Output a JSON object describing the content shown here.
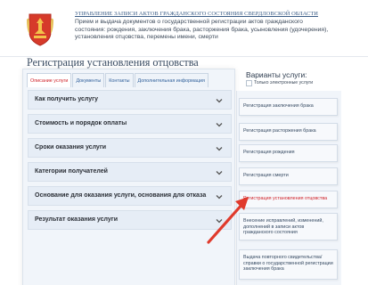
{
  "header": {
    "title": "УПРАВЛЕНИЕ ЗАПИСИ АКТОВ ГРАЖДАНСКОГО СОСТОЯНИЯ СВЕРДЛОВСКОЙ ОБЛАСТИ",
    "description": "Прием и выдача документов о государственной регистрации актов гражданского состояния: рождения, заключения брака, расторжения брака, усыновления (удочерения), установления отцовства, перемены имени, смерти"
  },
  "page_title": "Регистрация установления отцовства",
  "tabs": [
    {
      "label": "Описание услуги",
      "active": true
    },
    {
      "label": "Документы",
      "active": false
    },
    {
      "label": "Контакты",
      "active": false
    },
    {
      "label": "Дополнительная информация",
      "active": false
    }
  ],
  "accordion": [
    {
      "label": "Как получить услугу"
    },
    {
      "label": "Стоимость и порядок оплаты"
    },
    {
      "label": "Сроки оказания услуги"
    },
    {
      "label": "Категории получателей"
    },
    {
      "label": "Основание для оказания услуги, основания для отказа"
    },
    {
      "label": "Результат оказания услуги"
    }
  ],
  "sidebar": {
    "title": "Варианты услуги:",
    "checkbox_label": "Только электронные услуги",
    "items": [
      {
        "label": "Регистрация заключения брака"
      },
      {
        "label": "Регистрация расторжения брака"
      },
      {
        "label": "Регистрация рождения"
      },
      {
        "label": "Регистрация смерти"
      },
      {
        "label": "Регистрация установления отцовства",
        "active": true
      },
      {
        "label": "Внесение исправлений, изменений, дополнений в записи актов гражданского состояния"
      },
      {
        "label": "Выдача повторного свидетельства/справки о государственной регистрации заключения брака"
      }
    ]
  },
  "colors": {
    "accent_red": "#d0232a",
    "link_blue": "#2f5f9a",
    "panel_bg": "#f1f5fa"
  }
}
